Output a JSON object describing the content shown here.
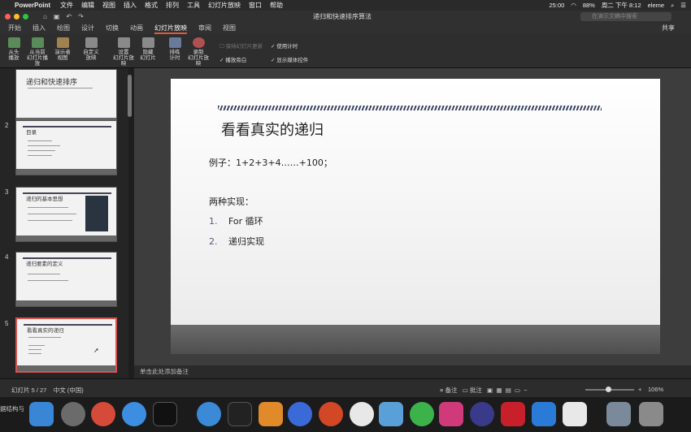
{
  "menubar": {
    "app": "PowerPoint",
    "items": [
      "文件",
      "编辑",
      "视图",
      "插入",
      "格式",
      "排列",
      "工具",
      "幻灯片放映",
      "窗口",
      "帮助"
    ],
    "time": "25:00",
    "battery": "88%",
    "clock": "周二 下午 8:12",
    "user": "eleme"
  },
  "window": {
    "title": "递归和快速排序算法",
    "search_placeholder": "在演示文稿中搜索"
  },
  "tabs": [
    "开始",
    "插入",
    "绘图",
    "设计",
    "切换",
    "动画",
    "幻灯片放映",
    "审阅",
    "视图"
  ],
  "active_tab": "幻灯片放映",
  "share_label": "共享",
  "ribbon": {
    "buttons": [
      {
        "label": "从头\n播放"
      },
      {
        "label": "从当前\n幻灯片播放"
      },
      {
        "label": "演示者\n视图"
      },
      {
        "label": "自定义\n放映"
      },
      {
        "label": "设置\n幻灯片放映"
      },
      {
        "label": "隐藏\n幻灯片"
      },
      {
        "label": "排练\n计时"
      },
      {
        "label": "录制\n幻灯片放映"
      }
    ],
    "options": {
      "keep_updated": "保持幻灯片更新",
      "play_narration": "播放旁白",
      "use_timings": "使用计时",
      "show_media_controls": "显示媒体控件"
    }
  },
  "thumbnails": [
    {
      "num": "",
      "title": "递归和快速排序"
    },
    {
      "num": "2",
      "title": "目录"
    },
    {
      "num": "3",
      "title": "递归的基本思想"
    },
    {
      "num": "4",
      "title": "递归要素的定义"
    },
    {
      "num": "5",
      "title": "看看真实的递归"
    }
  ],
  "slide": {
    "title": "看看真实的递归",
    "example": "例子：1+2+3+4……+100；",
    "two_impl": "两种实现：",
    "items": [
      {
        "n": "1.",
        "text": "For 循环"
      },
      {
        "n": "2.",
        "text": "递归实现"
      }
    ]
  },
  "notes_placeholder": "单击此处添加备注",
  "status": {
    "slide_pos": "幻灯片 5 / 27",
    "lang": "中文 (中国)",
    "notes": "备注",
    "comments": "批注",
    "zoom": "106%"
  },
  "dock_labels": {
    "left_cut": "据结构与"
  }
}
